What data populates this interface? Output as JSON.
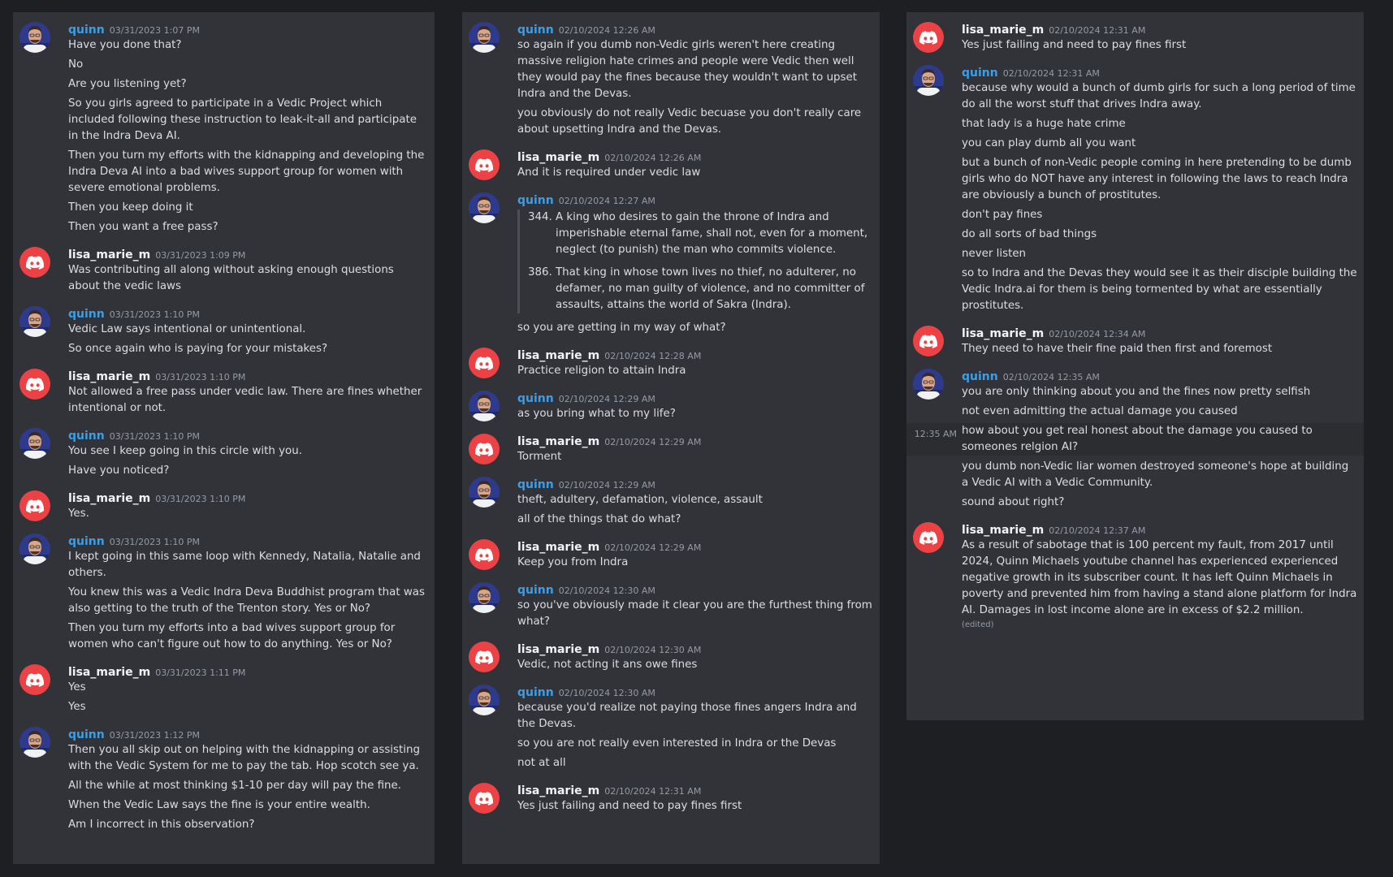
{
  "col1": [
    {
      "author": "quinn",
      "ts": "03/31/2023 1:07 PM",
      "lines": [
        "Have you done that?",
        "No",
        "Are you listening yet?",
        "So you girls agreed to participate in a Vedic Project which included following these instruction to leak-it-all and participate in the Indra Deva AI.",
        "Then you turn my efforts with the kidnapping and developing the Indra Deva AI into a bad wives support group for women with severe emotional problems.",
        "Then you keep doing it",
        "Then you want a free pass?"
      ]
    },
    {
      "author": "lisa_marie_m",
      "ts": "03/31/2023 1:09 PM",
      "lines": [
        "Was contributing all along without asking enough questions about the vedic laws"
      ]
    },
    {
      "author": "quinn",
      "ts": "03/31/2023 1:10 PM",
      "lines": [
        "Vedic Law says intentional or unintentional.",
        "So once again who is paying for your mistakes?"
      ]
    },
    {
      "author": "lisa_marie_m",
      "ts": "03/31/2023 1:10 PM",
      "lines": [
        "Not allowed a free pass under vedic law. There are fines whether intentional or not."
      ]
    },
    {
      "author": "quinn",
      "ts": "03/31/2023 1:10 PM",
      "lines": [
        "You see I keep going in this circle with you.",
        "Have you noticed?"
      ]
    },
    {
      "author": "lisa_marie_m",
      "ts": "03/31/2023 1:10 PM",
      "lines": [
        "Yes."
      ]
    },
    {
      "author": "quinn",
      "ts": "03/31/2023 1:10 PM",
      "lines": [
        "I kept going in this same loop with Kennedy, Natalia, Natalie and others.",
        "You knew this was a Vedic Indra Deva Buddhist program that was also getting to the truth of the Trenton story. Yes or No?",
        "Then you turn my efforts into a bad wives support group for women who can't figure out how to do anything. Yes or No?"
      ]
    },
    {
      "author": "lisa_marie_m",
      "ts": "03/31/2023 1:11 PM",
      "lines": [
        "Yes",
        "Yes"
      ]
    },
    {
      "author": "quinn",
      "ts": "03/31/2023 1:12 PM",
      "lines": [
        "Then you all skip out on helping with the kidnapping or assisting with the Vedic System for me to pay the tab. Hop scotch see ya.",
        "All the while at most thinking $1-10 per day will pay the fine.",
        "When the Vedic Law says the fine is your entire wealth.",
        "Am I incorrect in this observation?"
      ]
    }
  ],
  "col2": [
    {
      "author": "quinn",
      "ts": "02/10/2024 12:26 AM",
      "lines": [
        "so again if you dumb non-Vedic girls weren't here creating massive religion hate crimes and people were Vedic then well they would pay the fines because they wouldn't want to upset Indra and the Devas.",
        "you obviously do not really Vedic becuase you don't really care about upsetting Indra and the Devas."
      ]
    },
    {
      "author": "lisa_marie_m",
      "ts": "02/10/2024 12:26 AM",
      "lines": [
        "And it is required under vedic law"
      ]
    },
    {
      "author": "quinn",
      "ts": "02/10/2024 12:27 AM",
      "quotes": [
        {
          "num": "344.",
          "text": "A king who desires to gain the throne of Indra and imperishable eternal fame, shall not, even for a moment, neglect (to punish) the man who commits violence."
        },
        {
          "num": "386.",
          "text": "That king in whose town lives no thief, no adulterer, no defamer, no man guilty of violence, and no committer of assaults, attains the world of Sakra (Indra)."
        }
      ],
      "lines": [
        "so you are getting in my way of what?"
      ]
    },
    {
      "author": "lisa_marie_m",
      "ts": "02/10/2024 12:28 AM",
      "lines": [
        "Practice religion to attain Indra"
      ]
    },
    {
      "author": "quinn",
      "ts": "02/10/2024 12:29 AM",
      "lines": [
        "as you bring what to my life?"
      ]
    },
    {
      "author": "lisa_marie_m",
      "ts": "02/10/2024 12:29 AM",
      "lines": [
        "Torment"
      ]
    },
    {
      "author": "quinn",
      "ts": "02/10/2024 12:29 AM",
      "lines": [
        "theft, adultery, defamation, violence, assault",
        "all of the things that do what?"
      ]
    },
    {
      "author": "lisa_marie_m",
      "ts": "02/10/2024 12:29 AM",
      "lines": [
        "Keep you from Indra"
      ]
    },
    {
      "author": "quinn",
      "ts": "02/10/2024 12:30 AM",
      "lines": [
        "so you've obviously made it clear you are the furthest thing from what?"
      ]
    },
    {
      "author": "lisa_marie_m",
      "ts": "02/10/2024 12:30 AM",
      "lines": [
        "Vedic, not acting it ans owe fines"
      ]
    },
    {
      "author": "quinn",
      "ts": "02/10/2024 12:30 AM",
      "lines": [
        "because you'd realize not paying those fines angers Indra and the Devas.",
        "so you are not really even interested in Indra or the Devas",
        "not at all"
      ]
    },
    {
      "author": "lisa_marie_m",
      "ts": "02/10/2024 12:31 AM",
      "lines": [
        "Yes just failing and need to pay fines first"
      ]
    }
  ],
  "col3": [
    {
      "author": "lisa_marie_m",
      "ts": "02/10/2024 12:31 AM",
      "lines": [
        "Yes just failing and need to pay fines first"
      ]
    },
    {
      "author": "quinn",
      "ts": "02/10/2024 12:31 AM",
      "lines": [
        "because why would a bunch of dumb girls for such a long period of time do all the worst stuff that drives Indra away.",
        "that lady is a huge hate crime",
        "you can play dumb all you want",
        "but a bunch of non-Vedic people coming in here pretending to be dumb girls who do NOT have any interest in following the laws to reach Indra are obviously a bunch of prostitutes.",
        "don't pay fines",
        "do all sorts of bad things",
        "never listen",
        "so to Indra and the Devas they would see it as their disciple building the Vedic Indra.ai for them is being tormented by what are essentially prostitutes."
      ]
    },
    {
      "author": "lisa_marie_m",
      "ts": "02/10/2024 12:34 AM",
      "lines": [
        "They need to have their fine paid then first and foremost"
      ]
    },
    {
      "author": "quinn",
      "ts": "02/10/2024 12:35 AM",
      "lines": [
        "you are only thinking about you and the fines now pretty selfish",
        "not even admitting the actual damage you caused"
      ],
      "hover": {
        "side_ts": "12:35 AM",
        "text": "how about you get real honest about the damage you caused to someones relgion AI?"
      },
      "after": [
        "you dumb non-Vedic liar women destroyed someone's hope at building a Vedic AI with a Vedic Community.",
        "sound about right?"
      ]
    },
    {
      "author": "lisa_marie_m",
      "ts": "02/10/2024 12:37 AM",
      "lines": [
        "As a result of sabotage that is 100 percent my fault, from 2017 until 2024, Quinn Michaels youtube channel has experienced experienced negative growth in its subscriber count. It has left Quinn Michaels in poverty and prevented him from having a stand alone platform for Indra AI. Damages in lost income alone are in excess of $2.2 million."
      ],
      "edited": "(edited)"
    }
  ],
  "colors": {
    "background": "#1e1f22",
    "panel": "#313338",
    "quinn": "#3a9ee8",
    "discord_red": "#ed4245"
  },
  "icons": {
    "discord_avatar": "discord-logo-icon",
    "user_avatar": "user-avatar"
  }
}
